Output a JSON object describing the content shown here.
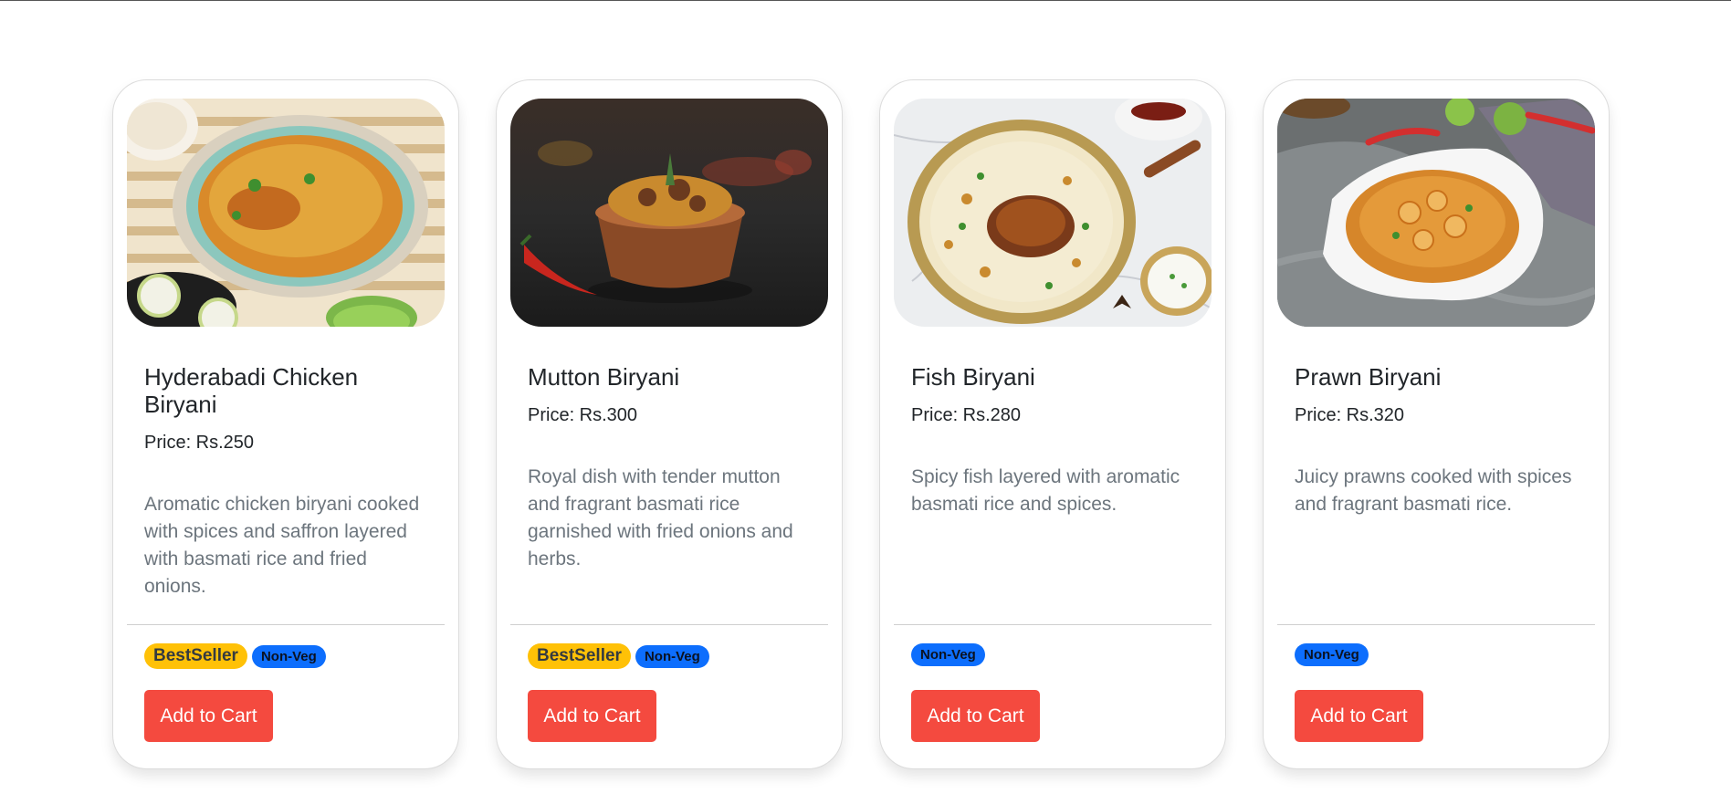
{
  "cards": [
    {
      "title": "Hyderabadi Chicken Biryani",
      "price": "Price: Rs.250",
      "description": "Aromatic chicken biryani cooked with spices and saffron layered with basmati rice and fried onions.",
      "badges": [
        "BestSeller",
        "Non-Veg"
      ],
      "button": "Add to Cart"
    },
    {
      "title": "Mutton Biryani",
      "price": "Price: Rs.300",
      "description": "Royal dish with tender mutton and fragrant basmati rice garnished with fried onions and herbs.",
      "badges": [
        "BestSeller",
        "Non-Veg"
      ],
      "button": "Add to Cart"
    },
    {
      "title": "Fish Biryani",
      "price": "Price: Rs.280",
      "description": "Spicy fish layered with aromatic basmati rice and spices.",
      "badges": [
        "Non-Veg"
      ],
      "button": "Add to Cart"
    },
    {
      "title": "Prawn Biryani",
      "price": "Price: Rs.320",
      "description": "Juicy prawns cooked with spices and fragrant basmati rice.",
      "badges": [
        "Non-Veg"
      ],
      "button": "Add to Cart"
    }
  ],
  "colors": {
    "button": "#f44a3f",
    "bestseller_badge": "#ffc107",
    "nonveg_badge": "#0d6efd"
  }
}
